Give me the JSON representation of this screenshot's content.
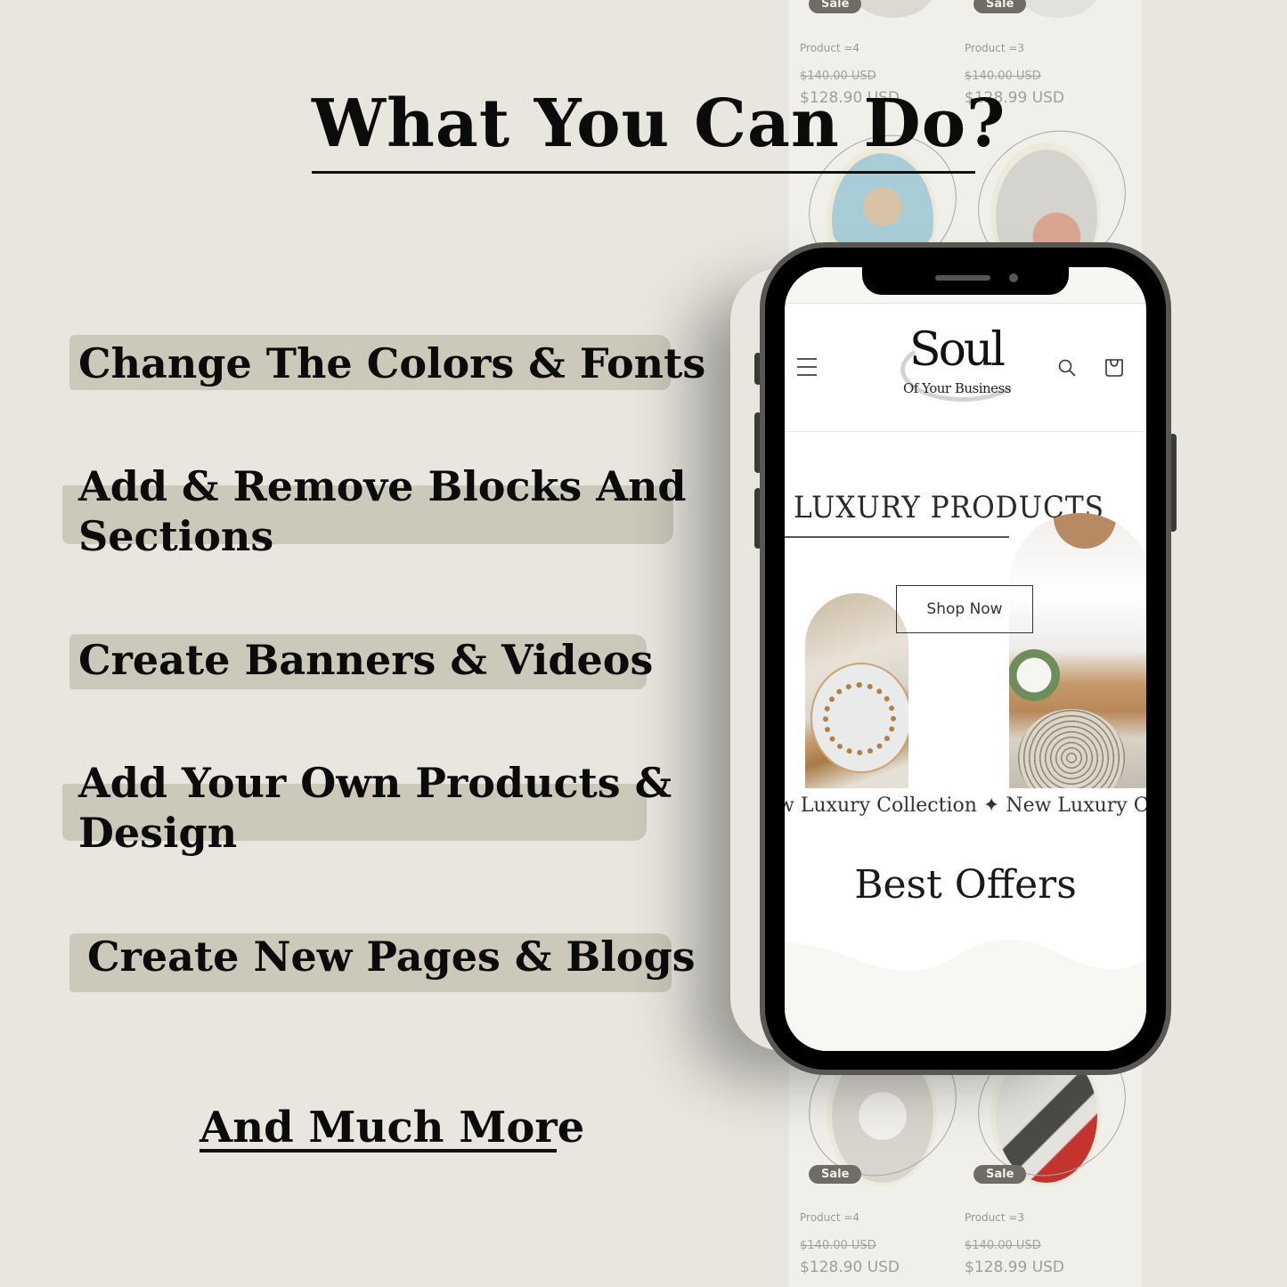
{
  "headline": "What You Can Do?",
  "features": [
    {
      "line1": "Change The Colors & Fonts",
      "line2": ""
    },
    {
      "line1": "Add & Remove Blocks And",
      "line2": "Sections"
    },
    {
      "line1": "Create Banners & Videos",
      "line2": ""
    },
    {
      "line1": "Add Your Own Products &",
      "line2": "Design"
    },
    {
      "line1": "Create New Pages & Blogs",
      "line2": ""
    }
  ],
  "footer_link": "And Much More",
  "background_store": {
    "products": [
      {
        "badge": "Sale",
        "name": "Product =4",
        "old_price": "$140.00 USD",
        "price": "$128.90 USD"
      },
      {
        "badge": "Sale",
        "name": "Product =3",
        "old_price": "$140.00 USD",
        "price": "$128.99 USD"
      }
    ]
  },
  "phone": {
    "header": {
      "logo_main": "Soul",
      "logo_sub": "Of Your Business",
      "menu_icon": "hamburger-icon",
      "search_icon": "search-icon",
      "cart_icon": "cart-icon"
    },
    "hero": {
      "title": "LUXURY PRODUCTS",
      "button": "Shop Now",
      "marquee": "w Luxury Collection ✦ New Luxury C"
    },
    "section_title": "Best Offers"
  },
  "colors": {
    "background": "#e9e6df",
    "brush": "#ccc9bb",
    "badge": "#6f6c66",
    "text": "#0b0b0b"
  }
}
